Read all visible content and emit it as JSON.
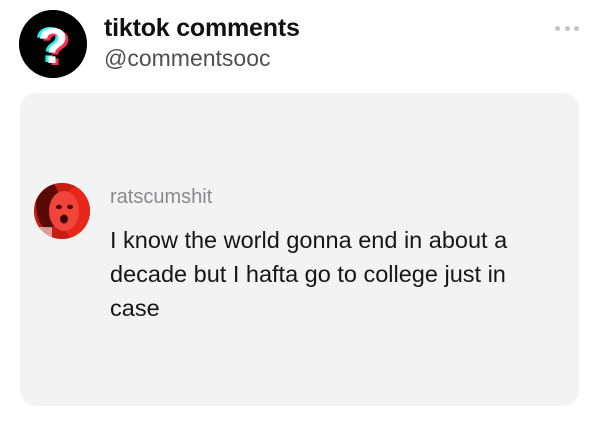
{
  "post": {
    "account_name": "tiktok comments",
    "account_handle": "@commentsooc",
    "avatar_icon": "question-mark-icon",
    "more_icon": "more-options-icon"
  },
  "comment": {
    "username": "ratscumshit",
    "text": "I know the world gonna end in about a decade but I hafta go to college just in case"
  },
  "colors": {
    "card_background": "#f3f3f4",
    "username": "#8a8a8e",
    "handle": "#505050",
    "avatar_red": "#c81d12"
  }
}
